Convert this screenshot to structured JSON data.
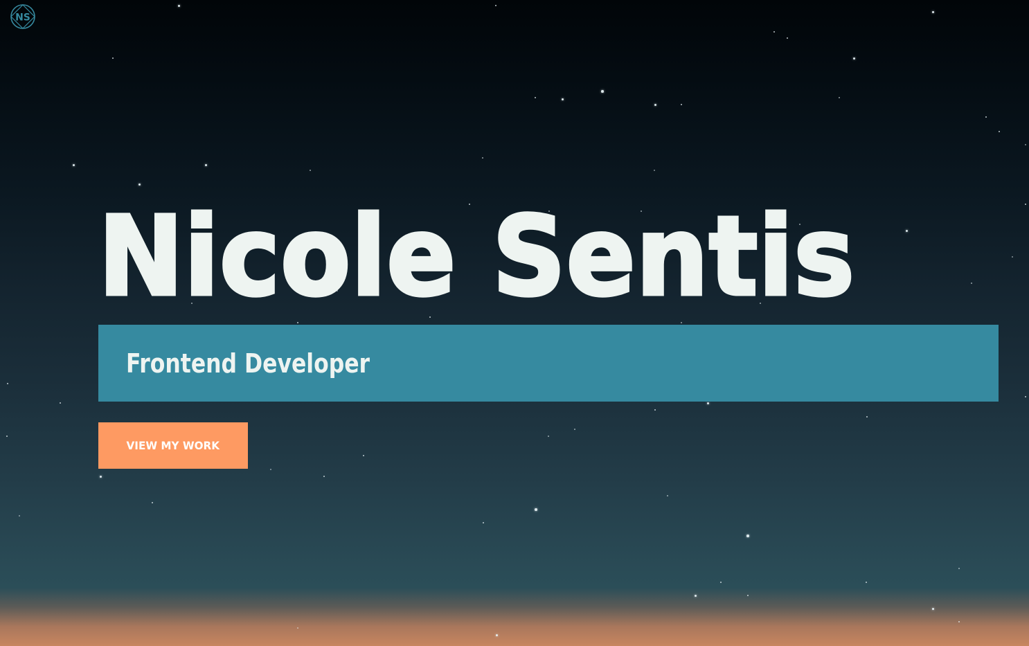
{
  "logo": {
    "monogram": "NS"
  },
  "hero": {
    "name": "Nicole Sentis",
    "role": "Frontend Developer",
    "cta_label": "VIEW MY WORK"
  },
  "colors": {
    "name_text": "#eef4f1",
    "role_bar": "#368aa0",
    "cta_background": "#fe9a62",
    "logo_stroke": "#368aa0"
  }
}
